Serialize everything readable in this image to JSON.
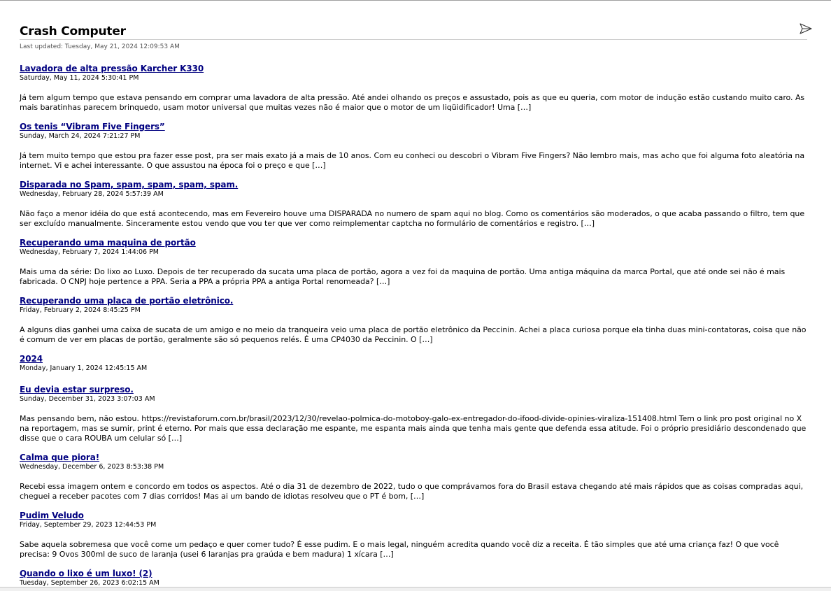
{
  "feed": {
    "title": "Crash Computer",
    "last_updated": "Last updated: Tuesday, May 21, 2024 12:09:53 AM",
    "toolbar_icon": "paper-plane-icon"
  },
  "entries": [
    {
      "title": "Lavadora de alta pressão Karcher K330",
      "date": "Saturday, May 11, 2024 5:30:41 PM",
      "summary": "Já tem algum tempo que estava pensando em comprar uma lavadora de alta pressão. Até andei olhando os preços e assustado, pois as que eu queria, com motor de indução estão custando muito caro. As mais baratinhas parecem brinquedo, usam motor universal que muitas vezes não é maior que o motor de um liqüidificador! Uma […]"
    },
    {
      "title": "Os tenis “Vibram Five Fingers”",
      "date": "Sunday, March 24, 2024 7:21:27 PM",
      "summary": "Já tem muito tempo que estou pra fazer esse post, pra ser mais exato já a mais de 10 anos. Com eu conheci ou descobri o Vibram Five Fingers? Não lembro mais, mas acho que foi alguma foto aleatória na internet. Vi e achei interessante. O que assustou na época foi o preço e que […]"
    },
    {
      "title": "Disparada no Spam, spam, spam, spam, spam.",
      "date": "Wednesday, February 28, 2024 5:57:39 AM",
      "summary": "Não faço a menor idéia do que está acontecendo, mas em Fevereiro houve uma DISPARADA no numero de spam aqui no blog. Como os comentários são moderados, o que acaba passando o filtro, tem que ser excluído manualmente. Sinceramente estou vendo que vou ter que ver como reimplementar captcha no formulário de comentários e registro. […]"
    },
    {
      "title": "Recuperando uma maquina de portão",
      "date": "Wednesday, February 7, 2024 1:44:06 PM",
      "summary": "Mais uma da série: Do lixo ao Luxo. Depois de ter recuperado da sucata uma placa de portão, agora a vez foi da maquina de portão. Uma antiga máquina da marca Portal, que até onde sei não é mais fabricada. O CNPJ hoje pertence a PPA. Seria a PPA a própria PPA a antiga Portal renomeada? […]"
    },
    {
      "title": "Recuperando uma placa de portão eletrônico.",
      "date": "Friday, February 2, 2024 8:45:25 PM",
      "summary": "A alguns dias ganhei uma caixa de sucata de um amigo e no meio da tranqueira veio uma placa de portão eletrônico da Peccinin. Achei a placa curiosa porque ela tinha duas mini-contatoras, coisa que não é comum de ver em placas de portão, geralmente são só pequenos relés. É uma CP4030 da Peccinin. O […]"
    },
    {
      "title": "2024",
      "date": "Monday, January 1, 2024 12:45:15 AM",
      "summary": ""
    },
    {
      "title": "Eu devia estar surpreso.",
      "date": "Sunday, December 31, 2023 3:07:03 AM",
      "summary": "Mas pensando bem, não estou. https://revistaforum.com.br/brasil/2023/12/30/revelao-polmica-do-motoboy-galo-ex-entregador-do-ifood-divide-opinies-viraliza-151408.html Tem o link pro post original  no X na reportagem, mas se sumir, print é eterno. Por mais que essa declaração me espante, me espanta mais ainda que tenha mais gente que defenda essa atitude. Foi o próprio presidiário descondenado que disse que o cara ROUBA um celular só […]"
    },
    {
      "title": "Calma que piora!",
      "date": "Wednesday, December 6, 2023 8:53:38 PM",
      "summary": "Recebi essa imagem ontem e concordo em todos os aspectos. Até o dia 31 de dezembro de 2022, tudo o que comprávamos fora do Brasil estava chegando até mais rápidos que as coisas compradas aqui, cheguei a receber pacotes com 7 dias corridos! Mas ai um bando de idiotas resolveu que o PT é bom, […]"
    },
    {
      "title": "Pudim Veludo",
      "date": "Friday, September 29, 2023 12:44:53 PM",
      "summary": "Sabe aquela sobremesa que você come um pedaço e quer comer tudo? É esse pudim. E o mais legal, ninguém acredita quando você diz a receita. É tão simples que até uma criança faz! O que você precisa: 9 Ovos 300ml de suco de laranja (usei 6 laranjas pra graúda e bem madura) 1 xícara […]"
    },
    {
      "title": "Quando o lixo é um luxo! (2)",
      "date": "Tuesday, September 26, 2023 6:02:15 AM",
      "summary": ""
    }
  ]
}
